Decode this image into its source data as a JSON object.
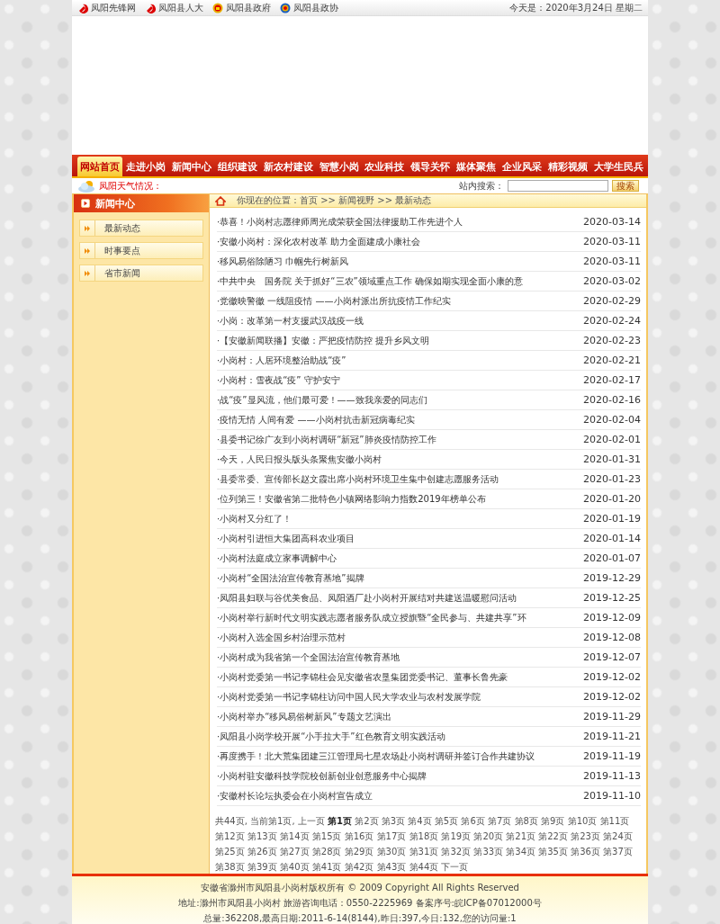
{
  "top_links": [
    {
      "label": "凤阳先锋网",
      "kind": "party"
    },
    {
      "label": "凤阳县人大",
      "kind": "party"
    },
    {
      "label": "凤阳县政府",
      "kind": "state"
    },
    {
      "label": "凤阳县政协",
      "kind": "cppcc"
    }
  ],
  "date_text": "今天是：2020年3月24日 星期二",
  "nav": [
    {
      "label": "网站首页",
      "selected": true
    },
    {
      "label": "走进小岗",
      "selected": false
    },
    {
      "label": "新闻中心",
      "selected": false
    },
    {
      "label": "组织建设",
      "selected": false
    },
    {
      "label": "新农村建设",
      "selected": false
    },
    {
      "label": "智慧小岗",
      "selected": false
    },
    {
      "label": "农业科技",
      "selected": false
    },
    {
      "label": "领导关怀",
      "selected": false
    },
    {
      "label": "媒体聚焦",
      "selected": false
    },
    {
      "label": "企业风采",
      "selected": false
    },
    {
      "label": "精彩视频",
      "selected": false
    },
    {
      "label": "大学生民兵",
      "selected": false
    }
  ],
  "weather_label": "凤阳天气情况：",
  "search": {
    "label": "站内搜索：",
    "button": "搜索"
  },
  "sidebar": {
    "title": "新闻中心",
    "items": [
      "最新动态",
      "时事要点",
      "省市新闻"
    ]
  },
  "breadcrumb": "你现在的位置：首页 >> 新闻视野 >> 最新动态",
  "news": [
    {
      "title": "·恭喜！小岗村志愿律师周光成荣获全国法律援助工作先进个人",
      "date": "2020-03-14"
    },
    {
      "title": "·安徽小岗村：深化农村改革 助力全面建成小康社会",
      "date": "2020-03-11"
    },
    {
      "title": "·移风易俗除陋习 巾帼先行树新风",
      "date": "2020-03-11"
    },
    {
      "title": "·中共中央　国务院 关于抓好“三农”领域重点工作 确保如期实现全面小康的意",
      "date": "2020-03-02"
    },
    {
      "title": "·党徽映警徽 一线阻疫情 ——小岗村派出所抗疫情工作纪实",
      "date": "2020-02-29"
    },
    {
      "title": "·小岗：改革第一村支援武汉战疫一线",
      "date": "2020-02-24"
    },
    {
      "title": "·【安徽新闻联播】安徽：严把疫情防控 提升乡风文明",
      "date": "2020-02-23"
    },
    {
      "title": "·小岗村：人居环境整治助战“疫”",
      "date": "2020-02-21"
    },
    {
      "title": "·小岗村：雪夜战“疫” 守护安宁",
      "date": "2020-02-17"
    },
    {
      "title": "·战“疫”显风流，他们最可爱！——致我亲爱的同志们",
      "date": "2020-02-16"
    },
    {
      "title": "·疫情无情 人间有爱 ——小岗村抗击新冠病毒纪实",
      "date": "2020-02-04"
    },
    {
      "title": "·县委书记徐广友到小岗村调研“新冠”肺炎疫情防控工作",
      "date": "2020-02-01"
    },
    {
      "title": "·今天，人民日报头版头条聚焦安徽小岗村",
      "date": "2020-01-31"
    },
    {
      "title": "·县委常委、宣传部长赵文霞出席小岗村环境卫生集中创建志愿服务活动",
      "date": "2020-01-23"
    },
    {
      "title": "·位列第三！安徽省第二批特色小镇网络影响力指数2019年榜单公布",
      "date": "2020-01-20"
    },
    {
      "title": "·小岗村又分红了！",
      "date": "2020-01-19"
    },
    {
      "title": "·小岗村引进恒大集团高科农业项目",
      "date": "2020-01-14"
    },
    {
      "title": "·小岗村法庭成立家事调解中心",
      "date": "2020-01-07"
    },
    {
      "title": "·小岗村“全国法治宣传教育基地”揭牌",
      "date": "2019-12-29"
    },
    {
      "title": "·凤阳县妇联与谷优美食品、凤阳酒厂赴小岗村开展结对共建送温暖慰问活动",
      "date": "2019-12-25"
    },
    {
      "title": "·小岗村举行新时代文明实践志愿者服务队成立授旗暨“全民参与、共建共享”环",
      "date": "2019-12-09"
    },
    {
      "title": "·小岗村入选全国乡村治理示范村",
      "date": "2019-12-08"
    },
    {
      "title": "·小岗村成为我省第一个全国法治宣传教育基地",
      "date": "2019-12-07"
    },
    {
      "title": "·小岗村党委第一书记李锦柱会见安徽省农垦集团党委书记、董事长鲁先豪",
      "date": "2019-12-02"
    },
    {
      "title": "·小岗村党委第一书记李锦柱访问中国人民大学农业与农村发展学院",
      "date": "2019-12-02"
    },
    {
      "title": "·小岗村举办“移风易俗树新风”专题文艺演出",
      "date": "2019-11-29"
    },
    {
      "title": "·凤阳县小岗学校开展“小手拉大手”红色教育文明实践活动",
      "date": "2019-11-21"
    },
    {
      "title": "·再度携手！北大荒集团建三江管理局七星农场赴小岗村调研并签订合作共建协议",
      "date": "2019-11-19"
    },
    {
      "title": "·小岗村驻安徽科技学院校创新创业创意服务中心揭牌",
      "date": "2019-11-13"
    },
    {
      "title": "·安徽村长论坛执委会在小岗村宣告成立",
      "date": "2019-11-10"
    }
  ],
  "pager": {
    "summary": "共44页, 当前第1页,",
    "prev": "上一页",
    "next": "下一页",
    "pages": [
      {
        "label": "第1页",
        "selected": true
      },
      {
        "label": "第2页",
        "selected": false
      },
      {
        "label": "第3页",
        "selected": false
      },
      {
        "label": "第4页",
        "selected": false
      },
      {
        "label": "第5页",
        "selected": false
      },
      {
        "label": "第6页",
        "selected": false
      },
      {
        "label": "第7页",
        "selected": false
      },
      {
        "label": "第8页",
        "selected": false
      },
      {
        "label": "第9页",
        "selected": false
      },
      {
        "label": "第10页",
        "selected": false
      },
      {
        "label": "第11页",
        "selected": false
      },
      {
        "label": "第12页",
        "selected": false
      },
      {
        "label": "第13页",
        "selected": false
      },
      {
        "label": "第14页",
        "selected": false
      },
      {
        "label": "第15页",
        "selected": false
      },
      {
        "label": "第16页",
        "selected": false
      },
      {
        "label": "第17页",
        "selected": false
      },
      {
        "label": "第18页",
        "selected": false
      },
      {
        "label": "第19页",
        "selected": false
      },
      {
        "label": "第20页",
        "selected": false
      },
      {
        "label": "第21页",
        "selected": false
      },
      {
        "label": "第22页",
        "selected": false
      },
      {
        "label": "第23页",
        "selected": false
      },
      {
        "label": "第24页",
        "selected": false
      },
      {
        "label": "第25页",
        "selected": false
      },
      {
        "label": "第26页",
        "selected": false
      },
      {
        "label": "第27页",
        "selected": false
      },
      {
        "label": "第28页",
        "selected": false
      },
      {
        "label": "第29页",
        "selected": false
      },
      {
        "label": "第30页",
        "selected": false
      },
      {
        "label": "第31页",
        "selected": false
      },
      {
        "label": "第32页",
        "selected": false
      },
      {
        "label": "第33页",
        "selected": false
      },
      {
        "label": "第34页",
        "selected": false
      },
      {
        "label": "第35页",
        "selected": false
      },
      {
        "label": "第36页",
        "selected": false
      },
      {
        "label": "第37页",
        "selected": false
      },
      {
        "label": "第38页",
        "selected": false
      },
      {
        "label": "第39页",
        "selected": false
      },
      {
        "label": "第40页",
        "selected": false
      },
      {
        "label": "第41页",
        "selected": false
      },
      {
        "label": "第42页",
        "selected": false
      },
      {
        "label": "第43页",
        "selected": false
      },
      {
        "label": "第44页",
        "selected": false
      }
    ]
  },
  "footer": [
    "安徽省滁州市凤阳县小岗村版权所有 © 2009 Copyright All Rights Reserved",
    "地址:滁州市凤阳县小岗村 旅游咨询电话：0550-2225969 备案序号:皖ICP备07012000号",
    "总量:362208,最高日期:2011-6-14(8144),昨日:397,今日:132,您的访问量:1"
  ]
}
